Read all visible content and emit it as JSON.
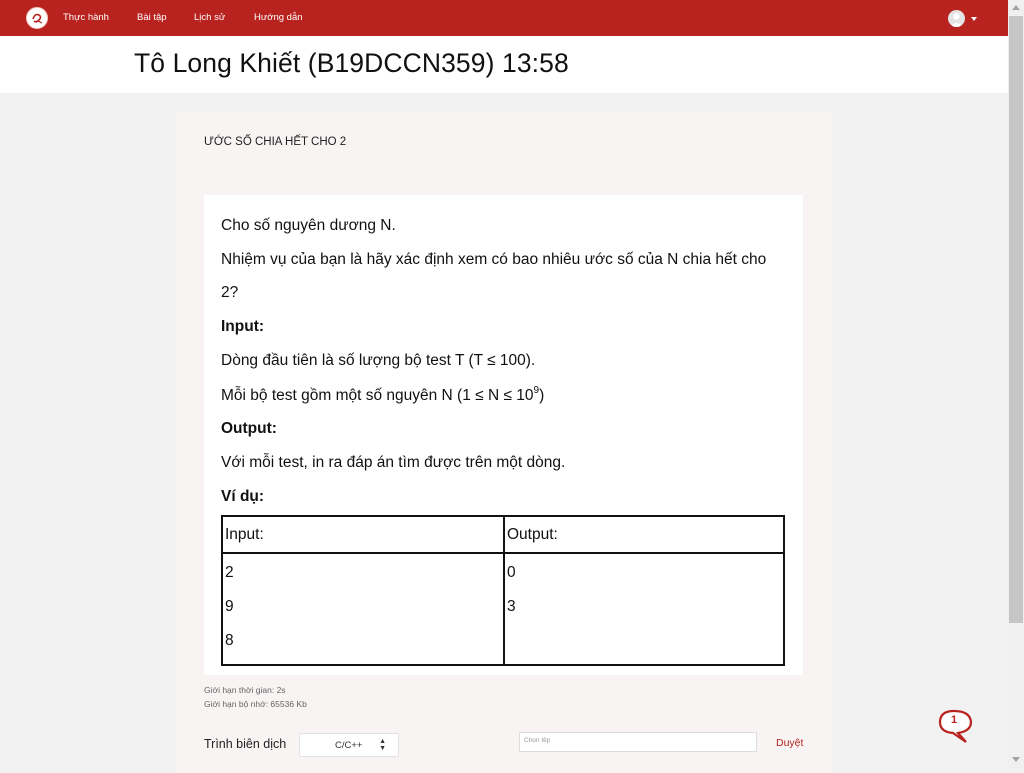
{
  "nav": {
    "items": [
      {
        "label": "Thực hành"
      },
      {
        "label": "Bài tập"
      },
      {
        "label": "Lịch sử"
      },
      {
        "label": "Hướng dẫn"
      }
    ]
  },
  "header": {
    "title": "Tô Long Khiết (B19DCCN359)  13:58"
  },
  "problem": {
    "title": "ƯỚC SỐ CHIA HẾT CHO 2",
    "statement_lines": [
      "Cho số nguyên dương N.",
      "Nhiệm vụ của bạn là hãy xác định xem có bao nhiêu ước số của N chia hết cho",
      "2?"
    ],
    "input_heading": "Input:",
    "input_lines": [
      "Dòng đầu tiên là số lượng bộ test T (T ≤ 100).",
      "Mỗi bộ test gồm một số nguyên N (1 ≤ N ≤ 10",
      "9",
      ")"
    ],
    "output_heading": "Output:",
    "output_line": "Với mỗi test, in ra đáp án tìm được trên một dòng.",
    "example_heading": "Ví dụ:",
    "sample": {
      "input_header": "Input:",
      "output_header": "Output:",
      "input_rows": [
        "2",
        "9",
        "8"
      ],
      "output_rows": [
        "0",
        "3"
      ]
    },
    "time_limit": "Giới hạn thời gian: 2s",
    "memory_limit": "Giới hạn bộ nhớ: 65536 Kb"
  },
  "submit": {
    "compiler_label": "Trình biên dịch",
    "compiler_value": "C/C++",
    "file_placeholder": "Chọn tệp",
    "browse_label": "Duyệt"
  },
  "chat": {
    "count": "1"
  },
  "colors": {
    "brand": "#b8231f"
  }
}
